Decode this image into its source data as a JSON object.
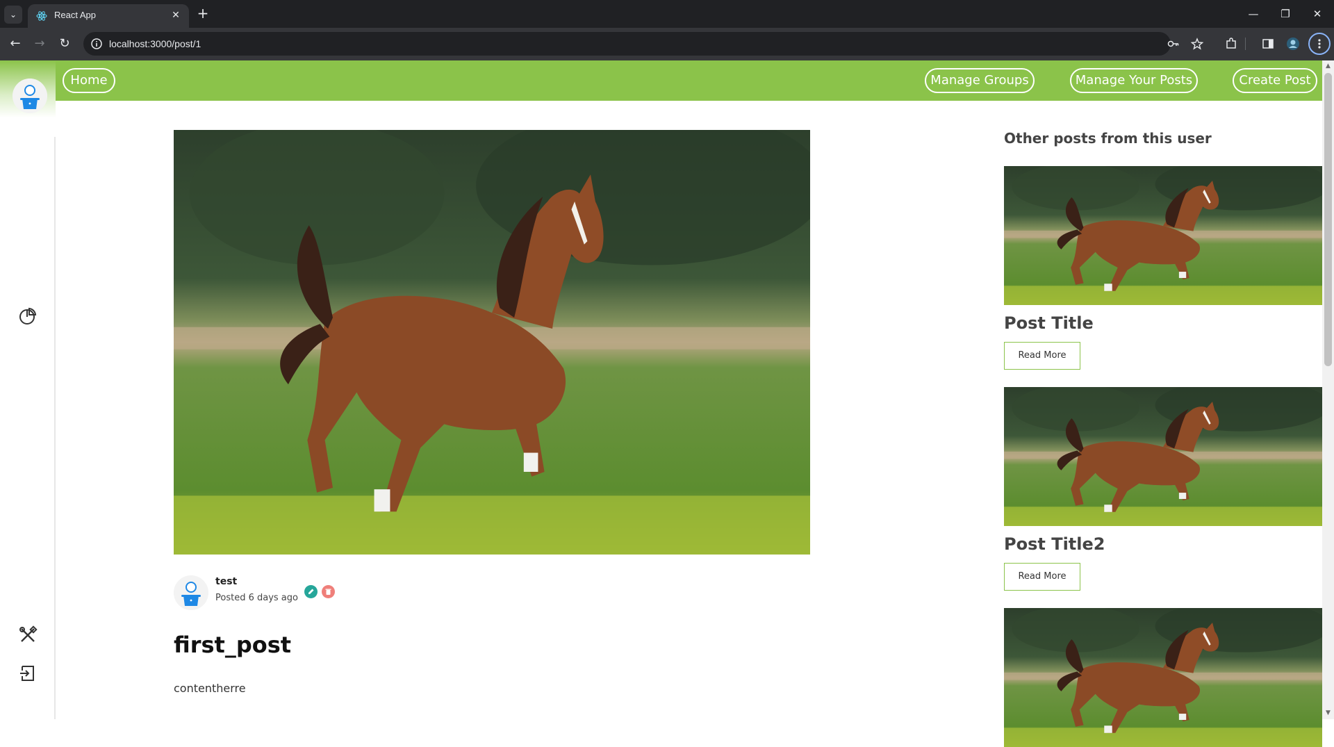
{
  "browser": {
    "tab_title": "React App",
    "url": "localhost:3000/post/1",
    "new_tab_glyph": "+",
    "close_glyph": "✕",
    "minimize_glyph": "—",
    "restore_glyph": "❐",
    "window_close_glyph": "✕",
    "back_glyph": "←",
    "forward_glyph": "→",
    "reload_glyph": "↻",
    "tab_menu_glyph": "⌄"
  },
  "nav": {
    "home": "Home",
    "manage_groups": "Manage Groups",
    "manage_posts": "Manage Your Posts",
    "create_post": "Create Post"
  },
  "sidebar": {
    "icons": [
      "user-avatar",
      "pie-chart-icon",
      "tools-icon",
      "logout-icon"
    ]
  },
  "post": {
    "author": "test",
    "posted": "Posted 6 days ago",
    "title": "first_post",
    "content": "contentherre"
  },
  "aside": {
    "heading": "Other posts from this user",
    "cards": [
      {
        "title": "Post Title",
        "button": "Read More"
      },
      {
        "title": "Post Title2",
        "button": "Read More"
      },
      {
        "title": "",
        "button": ""
      }
    ]
  },
  "colors": {
    "accent": "#8bc34a",
    "edit": "#26a69a",
    "delete": "#ef7f7a",
    "avatar_blue": "#1e88e5"
  }
}
